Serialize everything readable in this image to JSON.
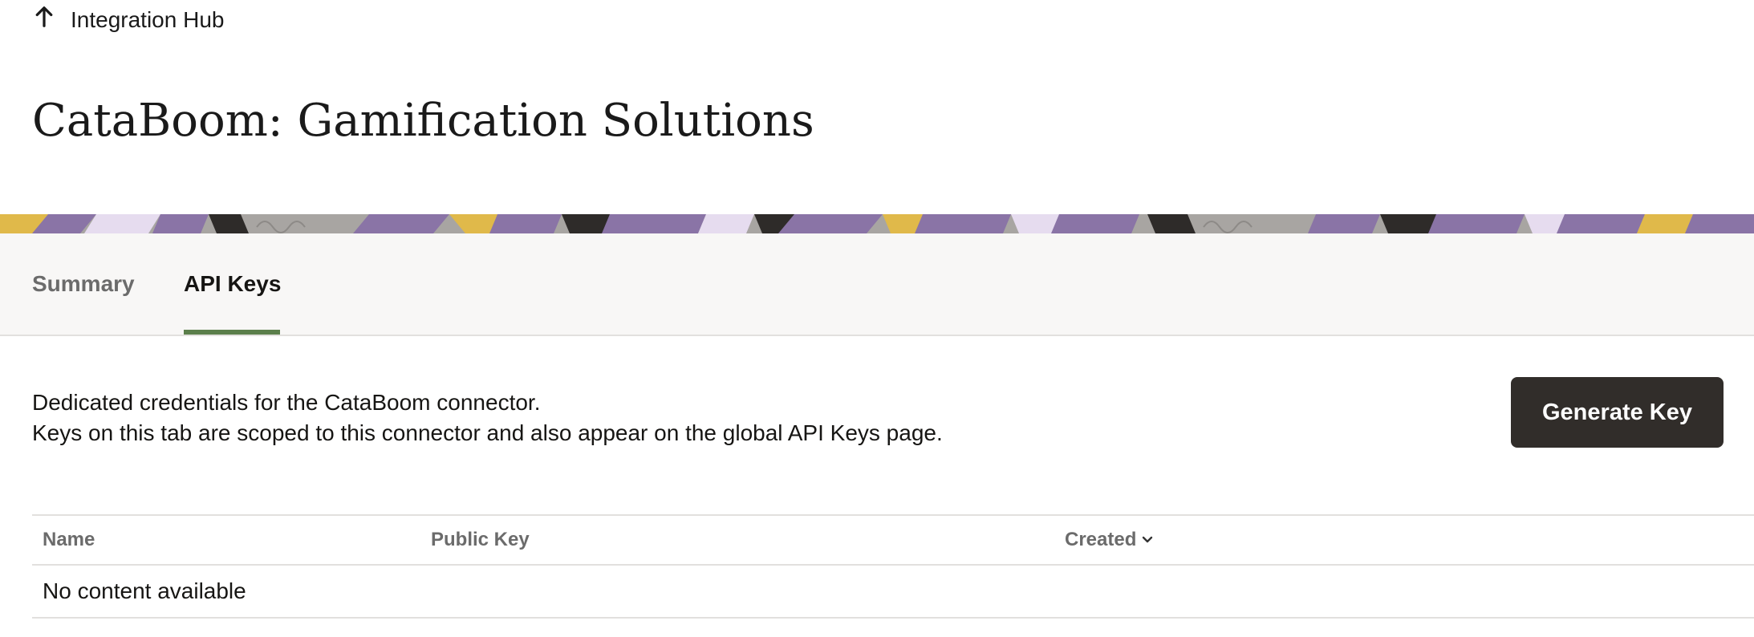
{
  "nav": {
    "back_label": "Integration Hub"
  },
  "page": {
    "title": "CataBoom: Gamification Solutions"
  },
  "tabs": [
    {
      "label": "Summary",
      "selected": false
    },
    {
      "label": "API Keys",
      "selected": true
    }
  ],
  "content": {
    "description_line1": "Dedicated credentials for the CataBoom connector.",
    "description_line2": "Keys on this tab are scoped to this connector and also appear on the global API Keys page.",
    "generate_button": "Generate Key"
  },
  "table": {
    "columns": [
      "Name",
      "Public Key",
      "Created"
    ],
    "sort_column": "Created",
    "empty_message": "No content available"
  },
  "colors": {
    "tab_indicator": "#5b7f4b",
    "button_bg": "#312d2a",
    "banner_purple": "#8a74a6",
    "banner_lavender": "#e6dcef",
    "banner_gold": "#e0b94a",
    "banner_gray": "#a8a5a2",
    "banner_dark": "#2e2b29"
  },
  "icons": {
    "back": "arrow-up-icon",
    "sort": "chevron-down-icon"
  }
}
